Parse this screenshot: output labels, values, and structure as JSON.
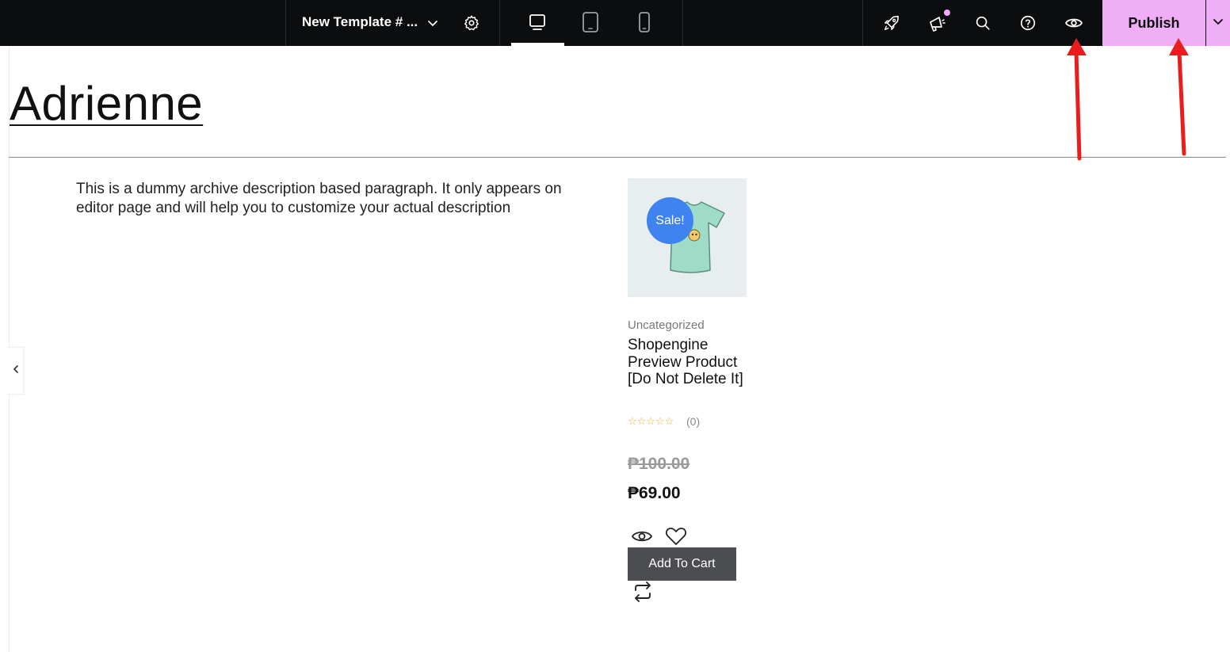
{
  "topbar": {
    "template_title": "New Template # ...",
    "publish_label": "Publish",
    "icons": [
      "chevron-down-icon",
      "gear-icon",
      "desktop-icon",
      "tablet-icon",
      "mobile-icon",
      "rocket-icon",
      "megaphone-icon",
      "search-icon",
      "help-icon",
      "eye-icon",
      "chevron-down-icon"
    ]
  },
  "archive": {
    "title": "Adrienne",
    "description": "This is a dummy archive description based paragraph. It only appears on editor page and will help you to customize your actual description"
  },
  "product": {
    "sale_badge": "Sale!",
    "category": "Uncategorized",
    "name": "Shopengine Preview Product [Do Not Delete It]",
    "stars": "☆☆☆☆☆",
    "rating_count": "(0)",
    "old_price": "₱100.00",
    "price": "₱69.00",
    "add_to_cart_label": "Add To Cart"
  },
  "colors": {
    "topbar_bg": "#0c0d0e",
    "publish_bg": "#f0aef7",
    "sale_badge": "#3f83f0",
    "cart_button": "#4b4d51",
    "star": "#f2b01e",
    "annotation_arrow": "#e81d1d"
  }
}
